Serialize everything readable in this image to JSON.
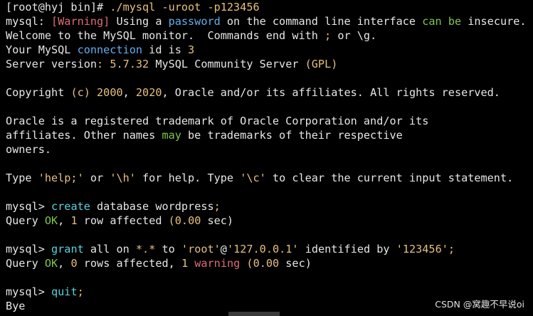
{
  "terminal": {
    "prompt": "[root@hyj bin]# ",
    "command": "./mysql -uroot -p123456",
    "warning_prefix": "mysql: ",
    "warning_tag": "[Warning]",
    "warning_text_1": " Using a ",
    "warning_password": "password",
    "warning_text_2": " on the command line interface ",
    "warning_can": "can",
    "warning_space": " ",
    "warning_be": "be",
    "warning_text_3": " insecure.",
    "welcome_1": "Welcome to the MySQL monitor.  Commands end with ",
    "welcome_semicolon": ";",
    "welcome_2": " or \\g.",
    "conn_1": "Your MySQL ",
    "conn_word": "connection",
    "conn_2": " id is ",
    "conn_id": "3",
    "server_1": "Server version",
    "server_colon": ":",
    "server_version": " 5.7.32",
    "server_2": " MySQL Community Server ",
    "server_gpl": "(GPL)",
    "copyright_1": "Copyright ",
    "copyright_c": "(c)",
    "copyright_space": " ",
    "copyright_y1": "2000",
    "copyright_comma": ", ",
    "copyright_y2": "2020",
    "copyright_2": ", Oracle and/or its affiliates. All rights reserved.",
    "oracle_1": "Oracle is a registered trademark of Oracle Corporation and/or its",
    "oracle_2a": "affiliates. Other names ",
    "oracle_may": "may",
    "oracle_2b": " be trademarks of their respective",
    "oracle_3": "owners.",
    "help_1": "Type ",
    "help_q1": "'help;'",
    "help_2": " or ",
    "help_q2": "'\\h'",
    "help_3": " for help. Type ",
    "help_q3": "'\\c'",
    "help_4": " to clear the current input statement.",
    "mysql_prompt": "mysql>",
    "cmd1_kw": " create",
    "cmd1_rest": " database wordpress",
    "cmd1_semi": ";",
    "res1_a": "Query ",
    "res1_ok": "OK",
    "res1_b": ", ",
    "res1_n": "1",
    "res1_c": " row affected ",
    "res1_time": "(0.00",
    "res1_d": " sec)",
    "cmd2_kw": " grant",
    "cmd2_a": " all on ",
    "cmd2_star": "*.*",
    "cmd2_b": " to ",
    "cmd2_user": "'root'",
    "cmd2_at": "@",
    "cmd2_host": "'127.0.0.1'",
    "cmd2_c": " identified by ",
    "cmd2_pw": "'123456'",
    "cmd2_semi": ";",
    "res2_a": "Query ",
    "res2_ok": "OK",
    "res2_b": ", ",
    "res2_n": "0",
    "res2_c": " rows affected, ",
    "res2_w": "1",
    "res2_space": " ",
    "res2_warning": "warning",
    "res2_space2": " ",
    "res2_time": "(0.00",
    "res2_d": " sec)",
    "cmd3_kw": " quit",
    "cmd3_semi": ";",
    "bye": "Bye"
  },
  "watermark": "CSDN @窝趣不早说oi"
}
